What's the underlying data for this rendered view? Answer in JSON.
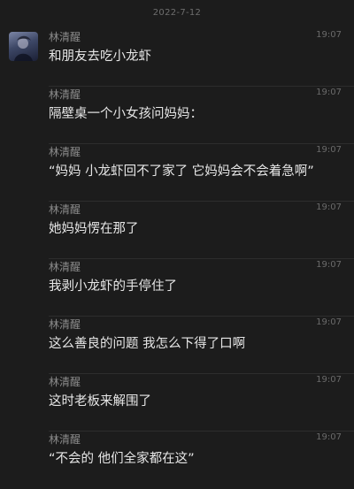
{
  "date_header": "2022-7-12",
  "messages": [
    {
      "sender": "林清醒",
      "time": "19:07",
      "text": "和朋友去吃小龙虾"
    },
    {
      "sender": "林清醒",
      "time": "19:07",
      "text": "隔壁桌一个小女孩问妈妈："
    },
    {
      "sender": "林清醒",
      "time": "19:07",
      "text": "“妈妈 小龙虾回不了家了 它妈妈会不会着急啊”"
    },
    {
      "sender": "林清醒",
      "time": "19:07",
      "text": "她妈妈愣在那了"
    },
    {
      "sender": "林清醒",
      "time": "19:07",
      "text": "我剥小龙虾的手停住了"
    },
    {
      "sender": "林清醒",
      "time": "19:07",
      "text": "这么善良的问题 我怎么下得了口啊"
    },
    {
      "sender": "林清醒",
      "time": "19:07",
      "text": "这时老板来解围了"
    },
    {
      "sender": "林清醒",
      "time": "19:07",
      "text": "“不会的 他们全家都在这”"
    }
  ]
}
